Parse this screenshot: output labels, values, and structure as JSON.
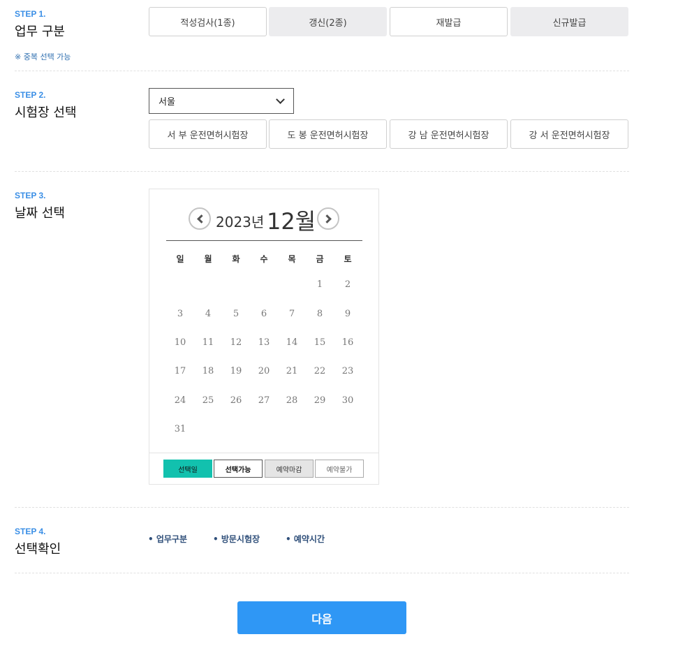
{
  "step1": {
    "label": "STEP 1.",
    "title": "업무 구분",
    "note": "※ 중복 선택 가능",
    "options": [
      "적성검사(1종)",
      "갱신(2종)",
      "재발급",
      "신규발급"
    ]
  },
  "step2": {
    "label": "STEP 2.",
    "title": "시험장 선택",
    "region": "서울",
    "centers": [
      "서 부 운전면허시험장",
      "도 봉 운전면허시험장",
      "강 남 운전면허시험장",
      "강 서 운전면허시험장"
    ]
  },
  "step3": {
    "label": "STEP 3.",
    "title": "날짜 선택",
    "calendar": {
      "year": "2023년",
      "month": "12월",
      "weekdays": [
        "일",
        "월",
        "화",
        "수",
        "목",
        "금",
        "토"
      ],
      "first_weekday": 5,
      "days": [
        "1",
        "2",
        "3",
        "4",
        "5",
        "6",
        "7",
        "8",
        "9",
        "10",
        "11",
        "12",
        "13",
        "14",
        "15",
        "16",
        "17",
        "18",
        "19",
        "20",
        "21",
        "22",
        "23",
        "24",
        "25",
        "26",
        "27",
        "28",
        "29",
        "30",
        "31"
      ]
    },
    "legend": {
      "selected": "선택일",
      "available": "선택가능",
      "closed": "예약마감",
      "unavailable": "예약불가"
    }
  },
  "step4": {
    "label": "STEP 4.",
    "title": "선택확인",
    "items": [
      "• 업무구분",
      "• 방문시험장",
      "• 예약시간"
    ]
  },
  "next_button": "다음",
  "colors": {
    "accent": "#2f97f5",
    "step_label": "#3b8fe6",
    "selected_day": "#12c1ae",
    "button_inactive": "#ececee"
  }
}
